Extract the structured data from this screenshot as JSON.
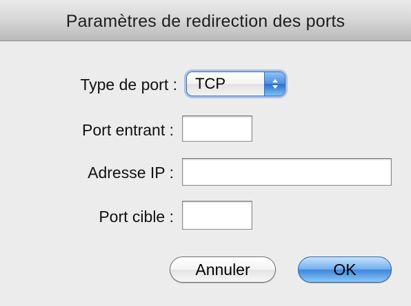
{
  "window": {
    "title": "Paramètres de redirection des ports"
  },
  "form": {
    "port_type_label": "Type de port :",
    "port_type_value": "TCP",
    "incoming_port_label": "Port entrant :",
    "incoming_port_value": "",
    "ip_address_label": "Adresse IP :",
    "ip_address_value": "",
    "target_port_label": "Port cible :",
    "target_port_value": ""
  },
  "buttons": {
    "cancel_label": "Annuler",
    "ok_label": "OK"
  },
  "icons": {
    "popup_arrows": "up-down-chevron-icon"
  },
  "colors": {
    "window_bg": "#ececec",
    "default_button_accent": "#3f86dd",
    "focus_ring": "#73a0e1"
  }
}
